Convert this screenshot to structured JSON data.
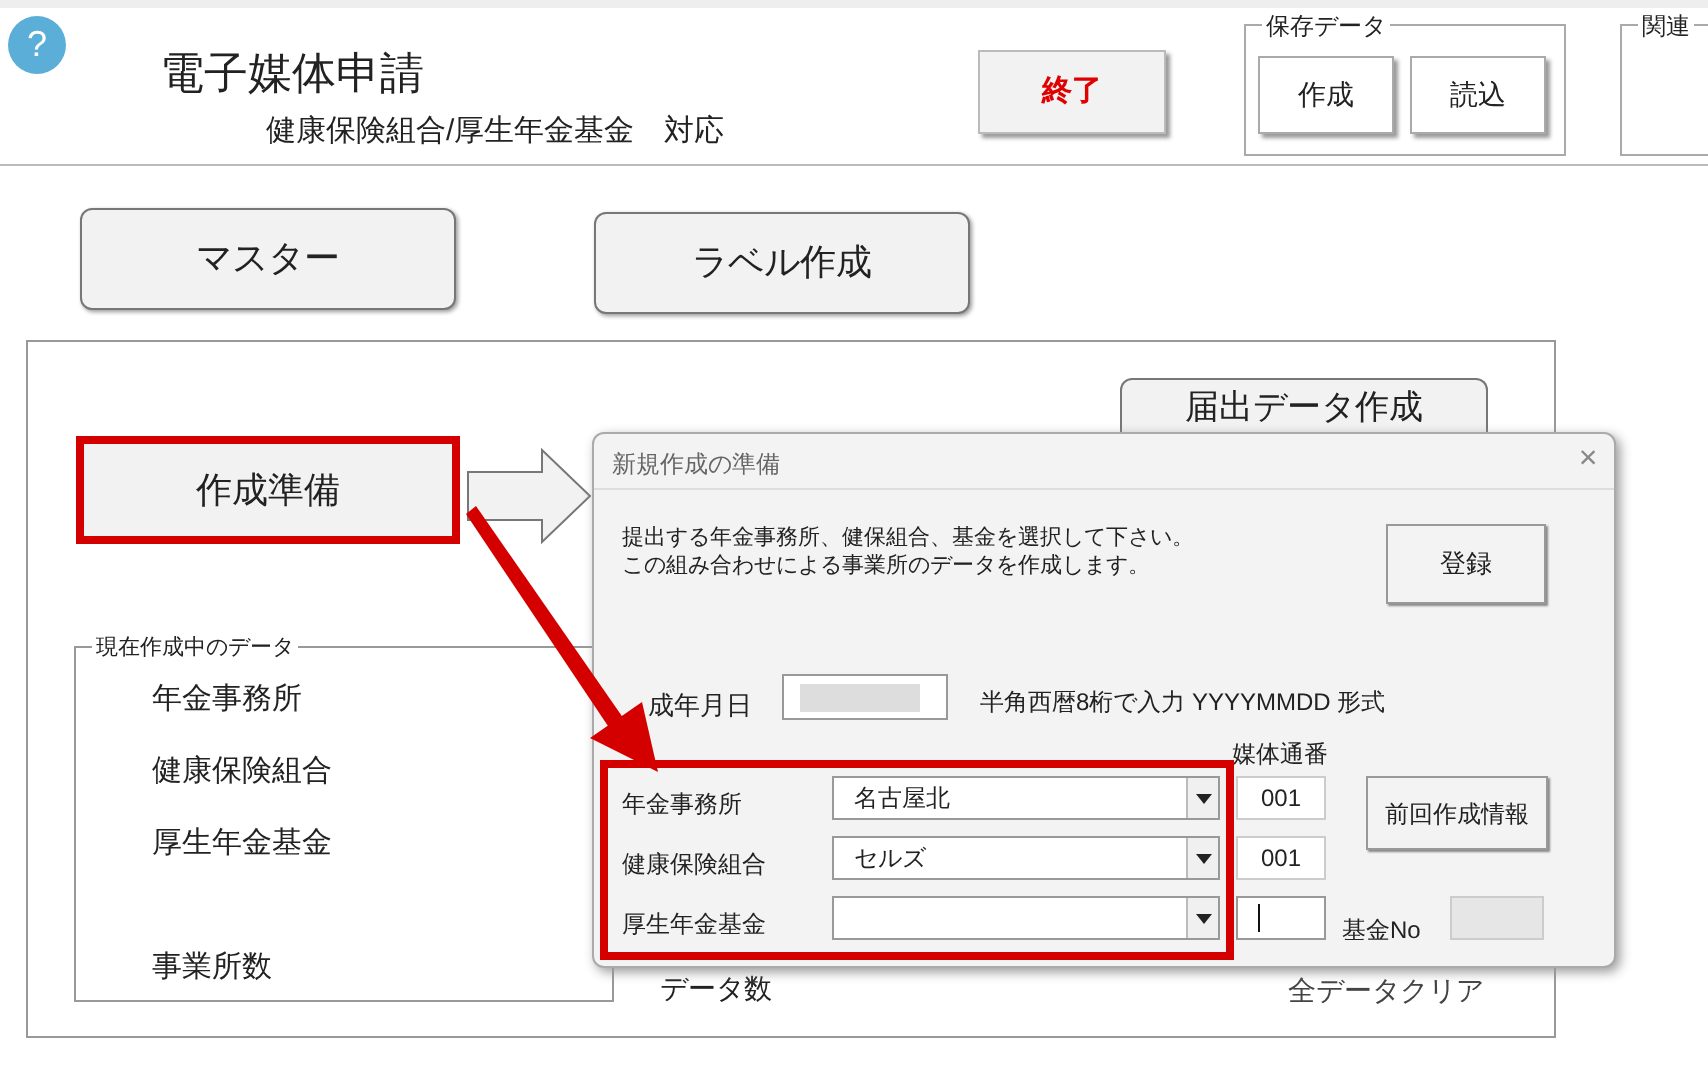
{
  "header": {
    "title": "電子媒体申請",
    "subtitle": "健康保険組合/厚生年金基金　対応",
    "help_icon": "?",
    "exit_button": "終了",
    "save_group": {
      "label": "保存データ",
      "buttons": [
        "作成",
        "読込"
      ]
    },
    "related_group": {
      "label": "関連"
    }
  },
  "main": {
    "top_buttons": [
      "マスター",
      "ラベル作成"
    ],
    "prepare_button": "作成準備",
    "submit_button": "届出データ作成",
    "current_data": {
      "label": "現在作成中のデータ",
      "rows": [
        "年金事務所",
        "健康保険組合",
        "厚生年金基金",
        "事業所数"
      ]
    },
    "data_count_label": "データ数",
    "clear_button": "全データクリア"
  },
  "dialog": {
    "title": "新規作成の準備",
    "description": [
      "提出する年金事務所、健保組合、基金を選択して下さい。",
      "この組み合わせによる事業所のデータを作成します。"
    ],
    "close_button": "×",
    "register_button": "登録",
    "date_label": "成年月日",
    "date_hint": "半角西暦8桁で入力  YYYYMMDD  形式",
    "serial_header": "媒体通番",
    "rows": [
      {
        "label": "年金事務所",
        "value": "名古屋北",
        "serial": "001",
        "focused": false
      },
      {
        "label": "健康保険組合",
        "value": "セルズ",
        "serial": "001",
        "focused": false
      },
      {
        "label": "厚生年金基金",
        "focused": true
      }
    ],
    "prev_button": "前回作成情報",
    "fund_no_label": "基金No"
  }
}
